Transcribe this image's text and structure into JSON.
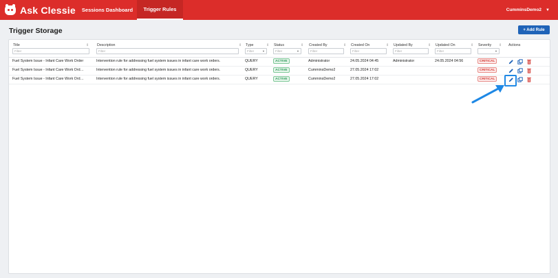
{
  "app": {
    "name": "Ask Clessie"
  },
  "nav": {
    "tabs": [
      {
        "label": "Sessions Dashboard"
      },
      {
        "label": "Trigger Rules"
      }
    ]
  },
  "user": {
    "name": "CumminsDemo2"
  },
  "page": {
    "title": "Trigger Storage",
    "add_button": "+ Add Rule"
  },
  "table": {
    "columns": [
      {
        "key": "title",
        "label": "Title",
        "filter": "Filter"
      },
      {
        "key": "description",
        "label": "Description",
        "filter": "Filter"
      },
      {
        "key": "type",
        "label": "Type",
        "filter": "Filter"
      },
      {
        "key": "status",
        "label": "Status",
        "filter": "Filter"
      },
      {
        "key": "created_by",
        "label": "Created By",
        "filter": "Filter"
      },
      {
        "key": "created_on",
        "label": "Created On",
        "filter": "Filter"
      },
      {
        "key": "updated_by",
        "label": "Updated By",
        "filter": "Filter"
      },
      {
        "key": "updated_on",
        "label": "Updated On",
        "filter": "Filter"
      },
      {
        "key": "severity",
        "label": "Severity",
        "filter": ""
      },
      {
        "key": "actions",
        "label": "Actions",
        "filter": ""
      }
    ],
    "rows": [
      {
        "title": "Fuel System Issue - Infant Care Work Order",
        "description": "Intervention rule for addressing fuel system issues in infant care work orders.",
        "type": "QUERY",
        "status": "ACTIVE",
        "created_by": "Administrator",
        "created_on": "24.05.2024 04:45",
        "updated_by": "Administrator",
        "updated_on": "24.05.2024 04:56",
        "severity": "CRITICAL"
      },
      {
        "title": "Fuel System Issue - Infant Care Work Ord…",
        "description": "Intervention rule for addressing fuel system issues in infant care work orders.",
        "type": "QUERY",
        "status": "ACTIVE",
        "created_by": "CumminsDemo2",
        "created_on": "27.05.2024 17:02",
        "updated_by": "",
        "updated_on": "",
        "severity": "CRITICAL"
      },
      {
        "title": "Fuel System Issue - Infant Care Work Ord…",
        "description": "Intervention rule for addressing fuel system issues in infant care work orders.",
        "type": "QUERY",
        "status": "ACTIVE",
        "created_by": "CumminsDemo2",
        "created_on": "27.05.2024 17:02",
        "updated_by": "",
        "updated_on": "",
        "severity": "CRITICAL"
      }
    ]
  },
  "colors": {
    "brand": "#dc2d2a",
    "primary": "#1f63b8",
    "active": "#2f9a5a",
    "critical": "#d33b35",
    "highlight": "#1e88e5"
  },
  "icons": {
    "edit": "pencil-icon",
    "copy": "copy-icon",
    "delete": "trash-icon",
    "menu": "chevron-down-icon"
  }
}
